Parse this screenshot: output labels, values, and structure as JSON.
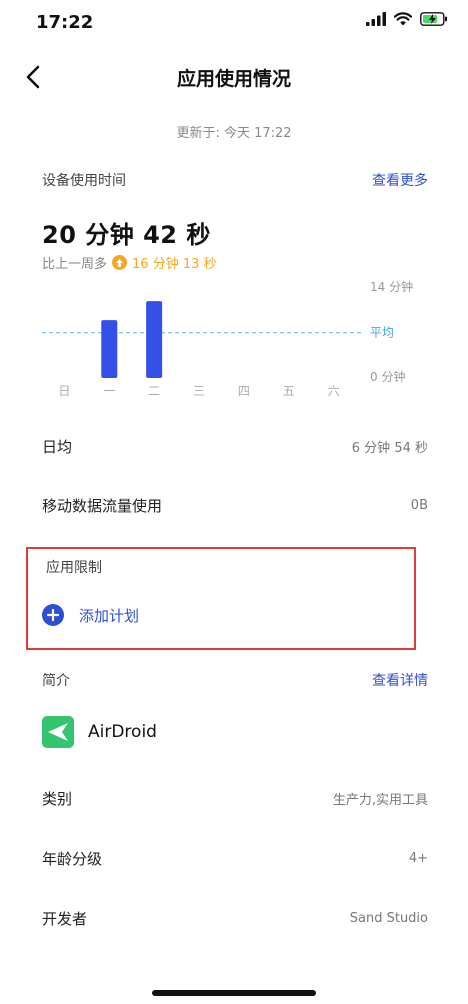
{
  "status_bar": {
    "time": "17:22"
  },
  "nav": {
    "title": "应用使用情况"
  },
  "updated": "更新于: 今天 17:22",
  "device_usage": {
    "label": "设备使用时间",
    "more_link": "查看更多",
    "total": "20 分钟 42 秒",
    "compare_prefix": "比上一周多",
    "compare_delta": "16 分钟 13 秒"
  },
  "chart_data": {
    "type": "bar",
    "categories": [
      "日",
      "一",
      "二",
      "三",
      "四",
      "五",
      "六"
    ],
    "values": [
      0,
      8.8,
      11.7,
      0,
      0,
      0,
      0
    ],
    "ylim": [
      0,
      14
    ],
    "y_tick_labels": [
      "14 分钟",
      "0 分钟"
    ],
    "average_label": "平均",
    "average_value": 6.9,
    "bar_color": "#3450e6",
    "average_line_color": "#7fc3e6"
  },
  "daily_average": {
    "label": "日均",
    "value": "6 分钟 54 秒"
  },
  "mobile_data": {
    "label": "移动数据流量使用",
    "value": "0B"
  },
  "app_limit": {
    "label": "应用限制",
    "add_plan": "添加计划"
  },
  "intro": {
    "label": "简介",
    "details_link": "查看详情",
    "app_name": "AirDroid",
    "app_icon": "airdroid-icon"
  },
  "details": [
    {
      "label": "类别",
      "value": "生产力,实用工具"
    },
    {
      "label": "年龄分级",
      "value": "4+"
    },
    {
      "label": "开发者",
      "value": "Sand Studio"
    }
  ],
  "colors": {
    "accent": "#2d4fd6",
    "warning": "#f5a623",
    "highlight": "#e23b3b",
    "app_icon_bg": "#34c36e"
  }
}
